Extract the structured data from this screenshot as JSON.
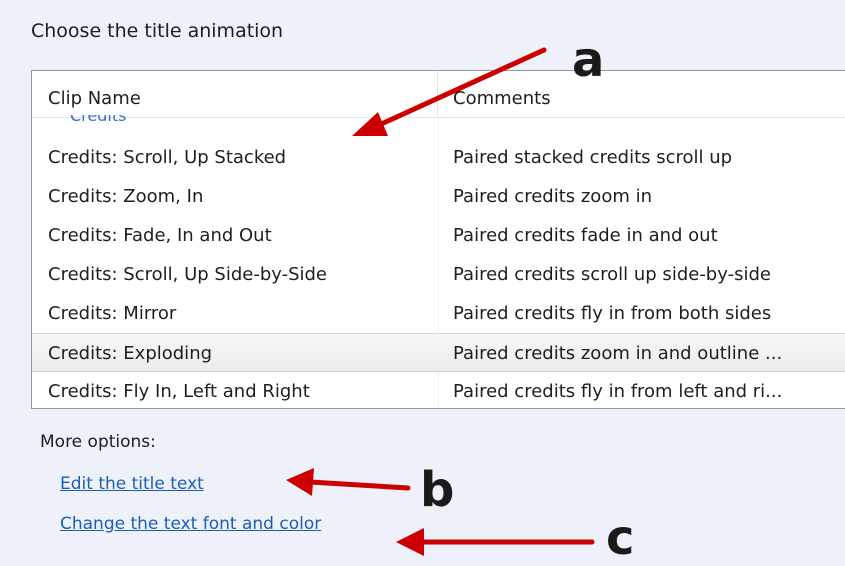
{
  "heading": "Choose the title animation",
  "table": {
    "columns": [
      "Clip Name",
      "Comments"
    ],
    "group_partial": "Credits",
    "rows": [
      {
        "name": "Credits: Scroll, Up Stacked",
        "comment": "Paired stacked credits scroll up"
      },
      {
        "name": "Credits: Zoom, In",
        "comment": "Paired credits zoom in"
      },
      {
        "name": "Credits: Fade, In and Out",
        "comment": "Paired credits fade in and out"
      },
      {
        "name": "Credits: Scroll, Up Side-by-Side",
        "comment": "Paired credits scroll up side-by-side"
      },
      {
        "name": "Credits: Mirror",
        "comment": "Paired credits fly in from both sides"
      },
      {
        "name": "Credits: Exploding",
        "comment": "Paired credits zoom in and outline ...",
        "selected": true
      },
      {
        "name": "Credits: Fly In, Left and Right",
        "comment": "Paired credits fly in from left and ri..."
      }
    ]
  },
  "more_options": {
    "label": "More options:",
    "links": [
      "Edit the title text",
      "Change the text font and color"
    ]
  },
  "annotations": {
    "a": "a",
    "b": "b",
    "c": "c",
    "arrow_color": "#cc0000"
  }
}
